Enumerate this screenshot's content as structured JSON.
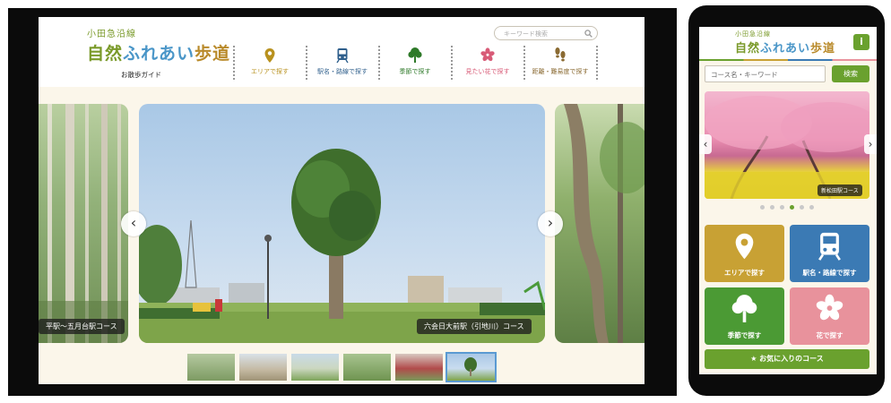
{
  "logo": {
    "line1": "小田急沿線",
    "line2_a": "自然",
    "line2_b": "ふれあい",
    "line2_c": "歩道",
    "guide": "お散歩ガイド"
  },
  "search": {
    "placeholder": "キーワード検索"
  },
  "nav": {
    "items": [
      {
        "label": "エリアで探す",
        "icon": "map-pin-icon",
        "color": "#b8911e"
      },
      {
        "label": "駅名・路線で探す",
        "icon": "train-icon",
        "color": "#2f5f8c"
      },
      {
        "label": "季節で探す",
        "icon": "tree-icon",
        "color": "#2f7a2a"
      },
      {
        "label": "見たい花で探す",
        "icon": "flower-icon",
        "color": "#d85b77"
      },
      {
        "label": "距離・難易度で探す",
        "icon": "footprints-icon",
        "color": "#8a6a32"
      }
    ]
  },
  "carousel": {
    "left_caption": "平駅〜五月台駅コース",
    "main_caption": "六会日大前駅（引地川）コース",
    "thumb_count": 6,
    "active_thumb": 6
  },
  "mobile": {
    "search_placeholder": "コース名・キーワード",
    "search_button": "検索",
    "slide_caption": "新松田駅コース",
    "dots": 6,
    "active_dot": 4,
    "tiles": [
      {
        "label": "エリアで探す",
        "icon": "map-pin-icon",
        "color": "#c8a134"
      },
      {
        "label": "駅名・路線で探す",
        "icon": "train-icon",
        "color": "#3b7ab4"
      },
      {
        "label": "季節で探す",
        "icon": "tree-icon",
        "color": "#4b9a34"
      },
      {
        "label": "花で探す",
        "icon": "flower-icon",
        "color": "#e8929c"
      }
    ],
    "favorites_label": "お気に入りのコース",
    "favorites_icon": "star-icon"
  }
}
